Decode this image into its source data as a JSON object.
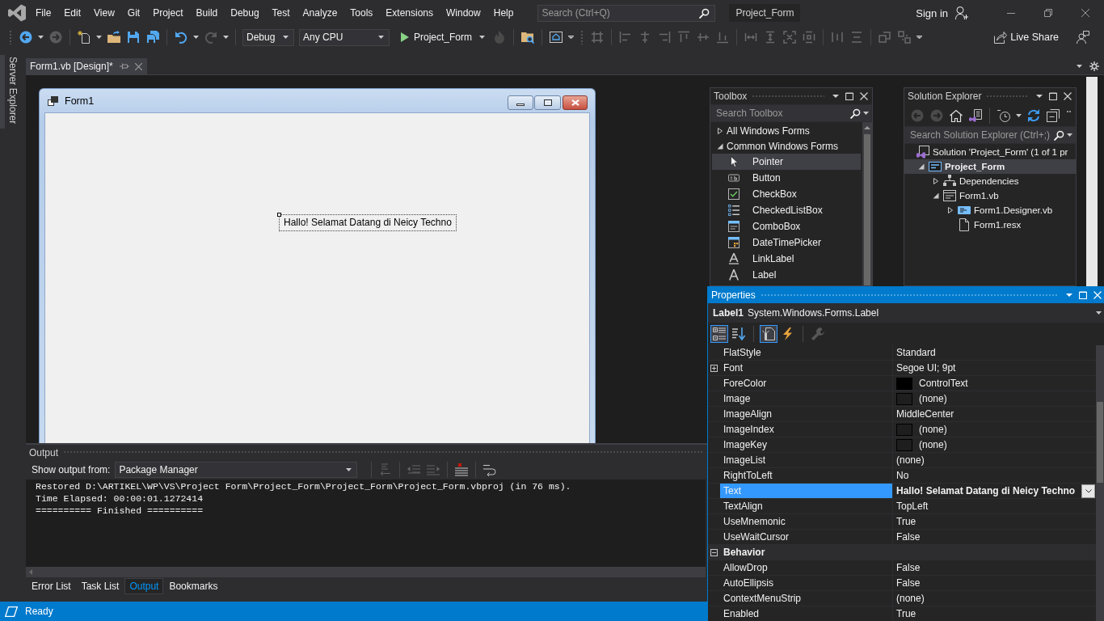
{
  "menu_bar": {
    "items": [
      "File",
      "Edit",
      "View",
      "Git",
      "Project",
      "Build",
      "Debug",
      "Test",
      "Analyze",
      "Tools",
      "Extensions",
      "Window",
      "Help"
    ],
    "search": {
      "placeholder": "Search (Ctrl+Q)"
    },
    "solution_name": "Project_Form",
    "sign_in": "Sign in"
  },
  "toolbar": {
    "configuration": "Debug",
    "platform": "Any CPU",
    "start": "Project_Form",
    "live_share": "Live Share"
  },
  "side_tabs": [
    {
      "label": "Server Explorer"
    }
  ],
  "document_tabs": [
    {
      "label": "Form1.vb [Design]*",
      "selected": true
    }
  ],
  "designer": {
    "form": {
      "title": "Form1",
      "label": "Hallo! Selamat Datang di Neicy Techno"
    }
  },
  "toolbox": {
    "title": "Toolbox",
    "search": {
      "placeholder": "Search Toolbox"
    },
    "groups": [
      {
        "label": "All Windows Forms",
        "expanded": false
      },
      {
        "label": "Common Windows Forms",
        "expanded": true,
        "items": [
          {
            "label": "Pointer",
            "kind": "pointer",
            "selected": true
          },
          {
            "label": "Button",
            "kind": "button",
            "selected": false
          },
          {
            "label": "CheckBox",
            "kind": "checkbox",
            "selected": false
          },
          {
            "label": "CheckedListBox",
            "kind": "checkedlistbox",
            "selected": false
          },
          {
            "label": "ComboBox",
            "kind": "combobox",
            "selected": false
          },
          {
            "label": "DateTimePicker",
            "kind": "datetimepicker",
            "selected": false
          },
          {
            "label": "LinkLabel",
            "kind": "linklabel",
            "selected": false
          },
          {
            "label": "Label",
            "kind": "label",
            "selected": false
          }
        ]
      }
    ]
  },
  "solution_explorer": {
    "title": "Solution Explorer",
    "search": {
      "placeholder": "Search Solution Explorer (Ctrl+;)"
    },
    "tree": [
      {
        "label": "Solution 'Project_Form' (1 of 1 pr",
        "kind": "solution",
        "selected": false,
        "children": [
          {
            "label": "Project_Form",
            "kind": "project",
            "expanded": true,
            "selected": true,
            "children": [
              {
                "label": "Dependencies",
                "kind": "dependencies",
                "expanded": false,
                "selected": false
              },
              {
                "label": "Form1.vb",
                "kind": "form",
                "expanded": true,
                "selected": false,
                "children": [
                  {
                    "label": "Form1.Designer.vb",
                    "kind": "code",
                    "expanded": false,
                    "selected": false
                  },
                  {
                    "label": "Form1.resx",
                    "kind": "resource",
                    "selected": false
                  }
                ]
              }
            ]
          }
        ]
      }
    ]
  },
  "output": {
    "title": "Output",
    "source_label": "Show output from:",
    "source": "Package Manager",
    "lines": [
      "Restored D:\\ARTIKEL\\WP\\VS\\Project Form\\Project_Form\\Project_Form\\Project_Form.vbproj (in 76 ms).",
      "Time Elapsed: 00:00:01.1272414",
      "========== Finished =========="
    ],
    "tabs": [
      {
        "label": "Error List",
        "selected": false
      },
      {
        "label": "Task List",
        "selected": false
      },
      {
        "label": "Output",
        "selected": true
      },
      {
        "label": "Bookmarks",
        "selected": false
      }
    ]
  },
  "status_bar": {
    "text": "Ready"
  },
  "properties": {
    "title": "Properties",
    "object_name": "Label1",
    "object_type": "System.Windows.Forms.Label",
    "view_buttons": [
      {
        "selected": true,
        "disabled": false
      },
      {
        "selected": false,
        "disabled": false
      },
      {
        "selected": true,
        "disabled": false
      },
      {
        "selected": false,
        "disabled": false
      },
      {
        "selected": false,
        "disabled": true
      }
    ],
    "rows": [
      {
        "kind": "text",
        "name": "FlatStyle",
        "value": "Standard",
        "selected": false,
        "modified": false
      },
      {
        "kind": "text",
        "name": "Font",
        "value": "Segoe UI; 9pt",
        "expanded": false,
        "selected": false,
        "modified": false
      },
      {
        "kind": "color",
        "name": "ForeColor",
        "value": "ControlText",
        "color": "#000000",
        "selected": false,
        "modified": false
      },
      {
        "kind": "image",
        "name": "Image",
        "value": "(none)",
        "selected": false,
        "modified": false
      },
      {
        "kind": "text",
        "name": "ImageAlign",
        "value": "MiddleCenter",
        "selected": false,
        "modified": false
      },
      {
        "kind": "image",
        "name": "ImageIndex",
        "value": "(none)",
        "selected": false,
        "modified": false
      },
      {
        "kind": "image",
        "name": "ImageKey",
        "value": "(none)",
        "selected": false,
        "modified": false
      },
      {
        "kind": "text",
        "name": "ImageList",
        "value": "(none)",
        "selected": false,
        "modified": false
      },
      {
        "kind": "text",
        "name": "RightToLeft",
        "value": "No",
        "selected": false,
        "modified": false
      },
      {
        "kind": "text",
        "name": "Text",
        "value": "Hallo! Selamat Datang di Neicy Techno",
        "selected": true,
        "modified": true
      },
      {
        "kind": "text",
        "name": "TextAlign",
        "value": "TopLeft",
        "selected": false,
        "modified": false
      },
      {
        "kind": "text",
        "name": "UseMnemonic",
        "value": "True",
        "selected": false,
        "modified": false
      },
      {
        "kind": "text",
        "name": "UseWaitCursor",
        "value": "False",
        "selected": false,
        "modified": false
      },
      {
        "kind": "category",
        "name": "Behavior",
        "expanded": true
      },
      {
        "kind": "text",
        "name": "AllowDrop",
        "value": "False",
        "selected": false,
        "modified": false
      },
      {
        "kind": "text",
        "name": "AutoEllipsis",
        "value": "False",
        "selected": false,
        "modified": false
      },
      {
        "kind": "text",
        "name": "ContextMenuStrip",
        "value": "(none)",
        "selected": false,
        "modified": false
      },
      {
        "kind": "text",
        "name": "Enabled",
        "value": "True",
        "selected": false,
        "modified": false
      }
    ]
  }
}
